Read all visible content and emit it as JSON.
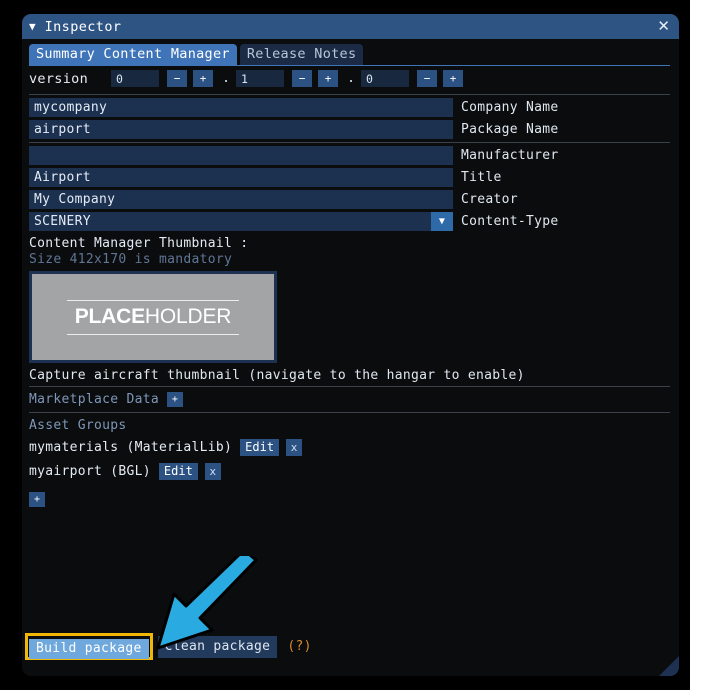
{
  "window": {
    "title": "Inspector",
    "collapse_icon": "triangle-down-icon",
    "close_icon": "close-icon",
    "close_glyph": "✕"
  },
  "tabs": [
    {
      "label": "Summary Content Manager",
      "active": true
    },
    {
      "label": "Release Notes",
      "active": false
    }
  ],
  "version": {
    "label": "version",
    "major": "0",
    "minor": "1",
    "patch": "0",
    "dot": ".",
    "minus": "−",
    "plus": "+"
  },
  "fields": [
    {
      "value": "mycompany",
      "label": "Company Name",
      "dropdown": false
    },
    {
      "value": "airport",
      "label": "Package Name",
      "dropdown": false
    },
    {
      "value": "",
      "label": "Manufacturer",
      "dropdown": false
    },
    {
      "value": "Airport",
      "label": "Title",
      "dropdown": false
    },
    {
      "value": "My Company",
      "label": "Creator",
      "dropdown": false
    },
    {
      "value": "SCENERY",
      "label": "Content-Type",
      "dropdown": true
    }
  ],
  "thumbnail": {
    "caption": "Content Manager Thumbnail :",
    "requirement": "Size 412x170 is mandatory",
    "placeholder_bold": "PLACE",
    "placeholder_regular": "HOLDER"
  },
  "capture": {
    "text": "Capture aircraft thumbnail (navigate to the hangar to enable)"
  },
  "marketplace": {
    "label": "Marketplace Data",
    "add_label": "+"
  },
  "asset_groups": {
    "header": "Asset Groups",
    "items": [
      {
        "name": "mymaterials (MaterialLib)",
        "edit_label": "Edit",
        "remove_label": "x"
      },
      {
        "name": "myairport (BGL)",
        "edit_label": "Edit",
        "remove_label": "x"
      }
    ],
    "add_label": "+"
  },
  "actions": {
    "build_label": "Build package",
    "clean_label": "Clean package",
    "help_label": "(?)"
  },
  "colors": {
    "titlebar": "#2e5484",
    "tab_active": "#3f74b8",
    "tab_inactive": "#1b2b45",
    "field_bg": "#1c3050",
    "accent_button": "#2c5283",
    "highlight_border": "#f2b705",
    "build_bg": "#6fa8dc",
    "help_orange": "#d98a2b",
    "arrow": "#29ABE2",
    "panel_bg": "#0b0c0e"
  }
}
